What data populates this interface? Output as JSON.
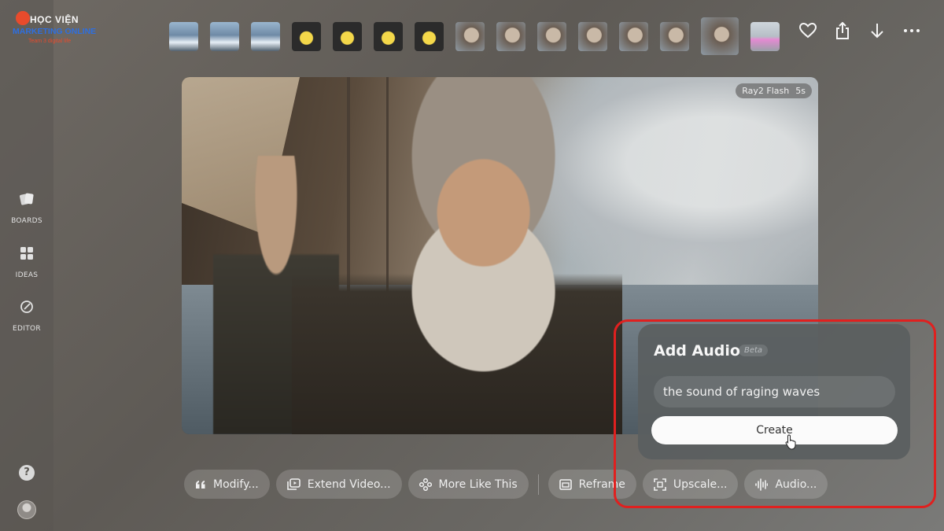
{
  "logo": {
    "line1": "HỌC VIỆN",
    "line2": "MARKETING ONLINE",
    "line3": "Team 3 digital life"
  },
  "sidebar": {
    "items": [
      {
        "label": "BOARDS",
        "icon": "boards-icon"
      },
      {
        "label": "IDEAS",
        "icon": "ideas-grid-icon"
      },
      {
        "label": "EDITOR",
        "icon": "editor-icon"
      }
    ],
    "help": "?"
  },
  "thumbnails": [
    {
      "kind": "mountain"
    },
    {
      "kind": "mountain"
    },
    {
      "kind": "mountain"
    },
    {
      "kind": "perfume"
    },
    {
      "kind": "perfume"
    },
    {
      "kind": "perfume"
    },
    {
      "kind": "perfume"
    },
    {
      "kind": "man"
    },
    {
      "kind": "man"
    },
    {
      "kind": "man"
    },
    {
      "kind": "man"
    },
    {
      "kind": "man"
    },
    {
      "kind": "man"
    },
    {
      "kind": "man",
      "active": true
    },
    {
      "kind": "pink-car"
    }
  ],
  "top_actions": [
    "heart-icon",
    "share-icon",
    "download-icon",
    "more-icon"
  ],
  "video": {
    "model": "Ray2 Flash",
    "duration": "5s"
  },
  "actions": [
    {
      "label": "Modify...",
      "icon": "quote-icon"
    },
    {
      "label": "Extend Video...",
      "icon": "extend-video-icon"
    },
    {
      "label": "More Like This",
      "icon": "more-like-this-icon"
    },
    {
      "label": "Reframe",
      "icon": "reframe-icon"
    },
    {
      "label": "Upscale...",
      "icon": "upscale-icon"
    },
    {
      "label": "Audio...",
      "icon": "audio-wave-icon"
    }
  ],
  "audio_popup": {
    "title": "Add Audio",
    "badge": "Beta",
    "prompt_value": "the sound of raging waves",
    "create_label": "Create"
  },
  "colors": {
    "highlight": "#e0201f",
    "brand_red": "#e84b2c",
    "brand_blue": "#2e6fe0"
  }
}
